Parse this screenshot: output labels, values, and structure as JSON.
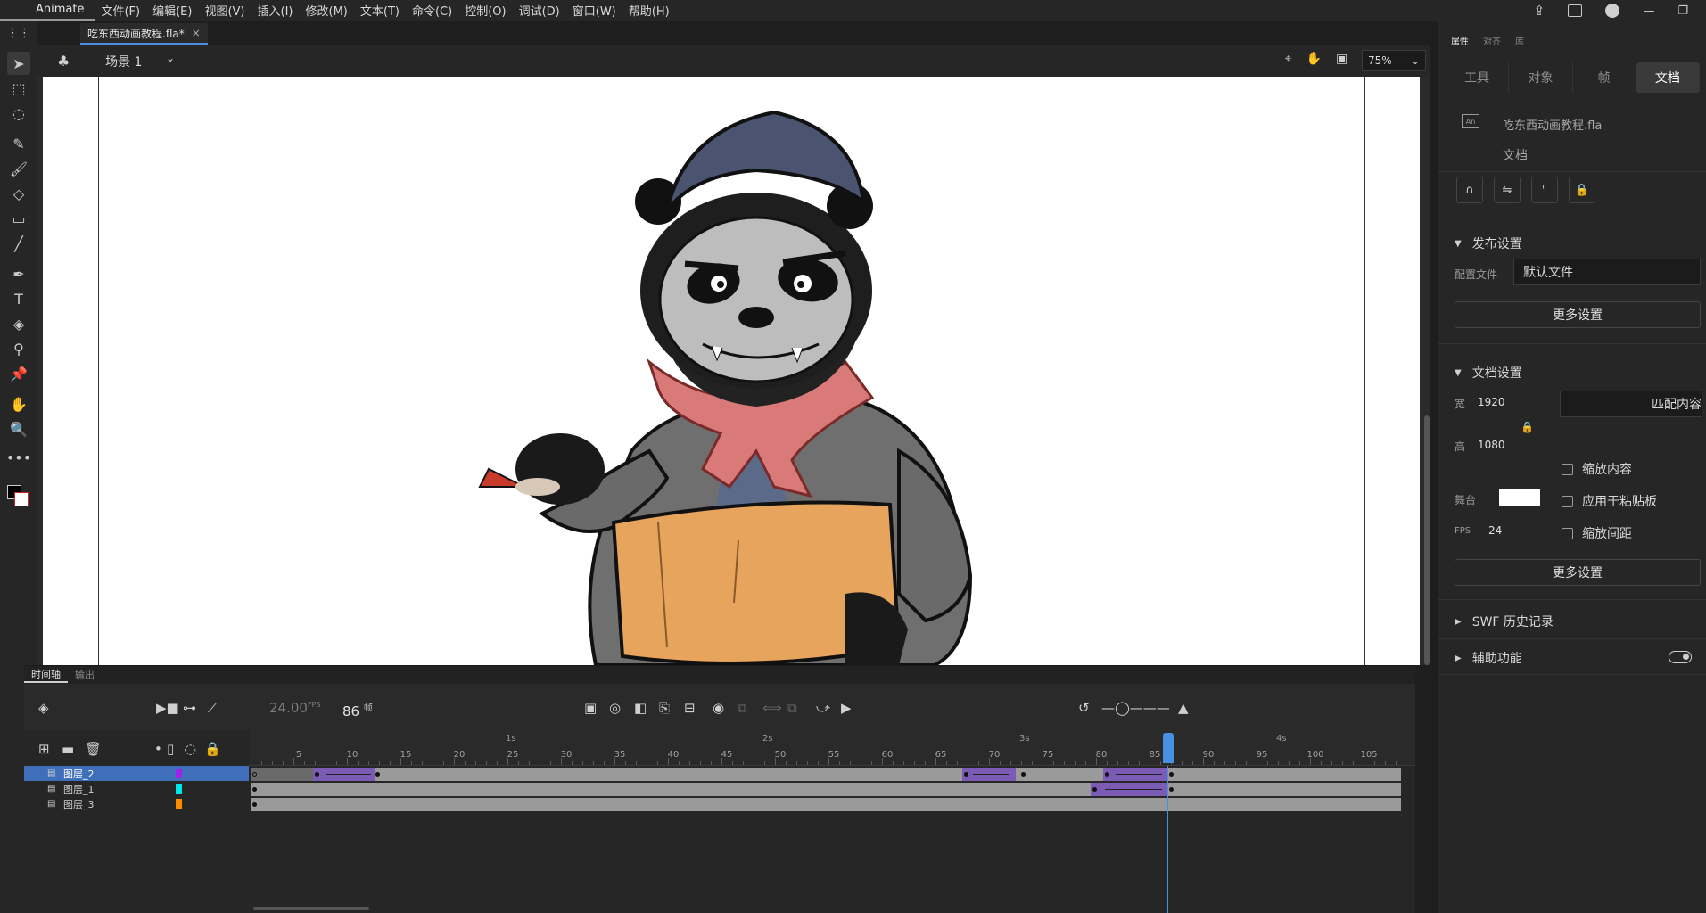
{
  "app": {
    "name": "Animate"
  },
  "menu": [
    "文件(F)",
    "编辑(E)",
    "视图(V)",
    "插入(I)",
    "修改(M)",
    "文本(T)",
    "命令(C)",
    "控制(O)",
    "调试(D)",
    "窗口(W)",
    "帮助(H)"
  ],
  "document": {
    "tab_title": "吃东西动画教程.fla*",
    "close": "×"
  },
  "scene": {
    "label": "场景 1",
    "zoom": "75%"
  },
  "timeline": {
    "tabs": [
      "时间轴",
      "输出"
    ],
    "fps": "24.00",
    "fps_unit": "FPS",
    "current_frame": "86",
    "frame_unit": "帧",
    "ruler_numbers": [
      "5",
      "10",
      "15",
      "20",
      "25",
      "30",
      "35",
      "40",
      "45",
      "50",
      "55",
      "60",
      "65",
      "70",
      "75",
      "80",
      "85",
      "90",
      "95",
      "100",
      "105"
    ],
    "ruler_seconds": [
      "1s",
      "2s",
      "3s",
      "4s"
    ],
    "layers": [
      {
        "name": "图层_2",
        "color": "#a020f0",
        "selected": true
      },
      {
        "name": "图层_1",
        "color": "#00e5e5",
        "selected": false
      },
      {
        "name": "图层_3",
        "color": "#ff8c00",
        "selected": false
      }
    ]
  },
  "properties": {
    "tabs": [
      "属性",
      "对齐",
      "库"
    ],
    "segments": [
      "工具",
      "对象",
      "帧",
      "文档"
    ],
    "file_name": "吃东西动画教程.fla",
    "doc_kind": "文档",
    "publish_section": "发布设置",
    "profile_label": "配置文件",
    "profile_value": "默认文件",
    "more_settings_1": "更多设置",
    "doc_section": "文档设置",
    "width_label": "宽",
    "width_value": "1920",
    "height_label": "高",
    "height_value": "1080",
    "match_contents": "匹配内容",
    "stage_label": "舞台",
    "fps_label": "FPS",
    "fps_value": "24",
    "scale_content": "缩放内容",
    "apply_pasteboard": "应用于粘贴板",
    "scale_spacing": "缩放间距",
    "more_settings_2": "更多设置",
    "swf_history": "SWF 历史记录",
    "accessibility": "辅助功能"
  }
}
